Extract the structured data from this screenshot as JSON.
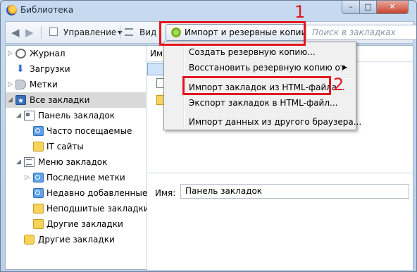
{
  "window": {
    "title": "Библиотека",
    "minimize": "–",
    "maximize": "□",
    "close": "✕"
  },
  "toolbar": {
    "back": "◀",
    "forward": "▶",
    "organize_label": "Управление",
    "views_label": "Вид",
    "import_label": "Импорт и резервные копии",
    "search_placeholder": "Поиск в закладках"
  },
  "menu": {
    "items": [
      {
        "label": "Создать резервную копию..."
      },
      {
        "label": "Восстановить резервную копию от",
        "submenu": "▶"
      },
      {
        "label": "Импорт закладок из HTML-файла..."
      },
      {
        "label": "Экспорт закладок в HTML-файл..."
      },
      {
        "label": "Импорт данных из другого браузера..."
      }
    ]
  },
  "sidebar": {
    "items": [
      {
        "label": "Журнал",
        "icon": "clock-icon"
      },
      {
        "label": "Загрузки",
        "icon": "download-icon"
      },
      {
        "label": "Метки",
        "icon": "tag-icon"
      },
      {
        "label": "Все закладки",
        "icon": "star-icon"
      },
      {
        "label": "Панель закладок",
        "icon": "toolbar-icon"
      },
      {
        "label": "Часто посещаемые",
        "icon": "smart-folder-icon"
      },
      {
        "label": "IT сайты",
        "icon": "folder-icon"
      },
      {
        "label": "Меню закладок",
        "icon": "menu-icon"
      },
      {
        "label": "Последние метки",
        "icon": "smart-folder-icon"
      },
      {
        "label": "Недавно добавленные",
        "icon": "smart-folder-icon"
      },
      {
        "label": "Неподшитые закладки",
        "icon": "folder-icon"
      },
      {
        "label": "Другие закладки",
        "icon": "folder-icon"
      },
      {
        "label": "Другие закладки",
        "icon": "star-folder-icon"
      }
    ]
  },
  "content": {
    "column_name": "Имя",
    "details_name_label": "Имя:",
    "details_name_value": "Панель закладок"
  },
  "annotations": {
    "step1": "1",
    "step2": "2",
    "color": "#e1161e"
  }
}
